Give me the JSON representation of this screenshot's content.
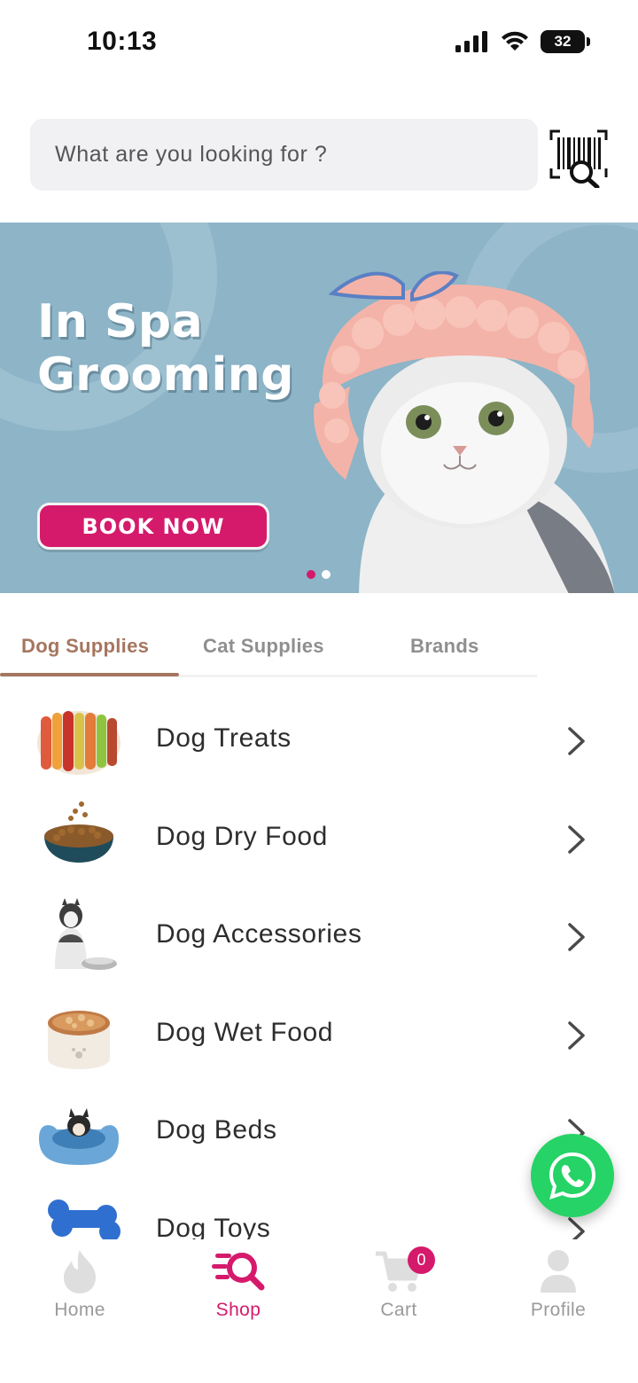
{
  "status_bar": {
    "time": "10:13",
    "battery_level": "32"
  },
  "search": {
    "placeholder": "What are you looking for ?"
  },
  "banner": {
    "title_line1": "In Spa",
    "title_line2": "Grooming",
    "cta_label": "BOOK NOW",
    "slide_count": 2,
    "active_slide": 1
  },
  "tabs": [
    {
      "label": "Dog Supplies",
      "active": true
    },
    {
      "label": "Cat Supplies",
      "active": false
    },
    {
      "label": "Brands",
      "active": false
    }
  ],
  "categories": [
    {
      "label": "Dog Treats",
      "icon": "dog-treats-thumb"
    },
    {
      "label": "Dog Dry Food",
      "icon": "dog-dry-food-thumb"
    },
    {
      "label": "Dog Accessories",
      "icon": "dog-accessories-thumb"
    },
    {
      "label": "Dog Wet Food",
      "icon": "dog-wet-food-thumb"
    },
    {
      "label": "Dog Beds",
      "icon": "dog-beds-thumb"
    },
    {
      "label": "Dog Toys",
      "icon": "dog-toys-thumb"
    }
  ],
  "bottom_nav": {
    "items": [
      {
        "label": "Home",
        "icon": "flame-icon"
      },
      {
        "label": "Shop",
        "icon": "shop-search-icon",
        "active": true
      },
      {
        "label": "Cart",
        "icon": "cart-icon"
      },
      {
        "label": "Profile",
        "icon": "user-icon"
      }
    ],
    "cart_count": "0"
  },
  "colors": {
    "accent": "#d51a6c",
    "tab_active": "#a5765f",
    "banner_bg": "#8db4c7",
    "whatsapp": "#25d366"
  }
}
